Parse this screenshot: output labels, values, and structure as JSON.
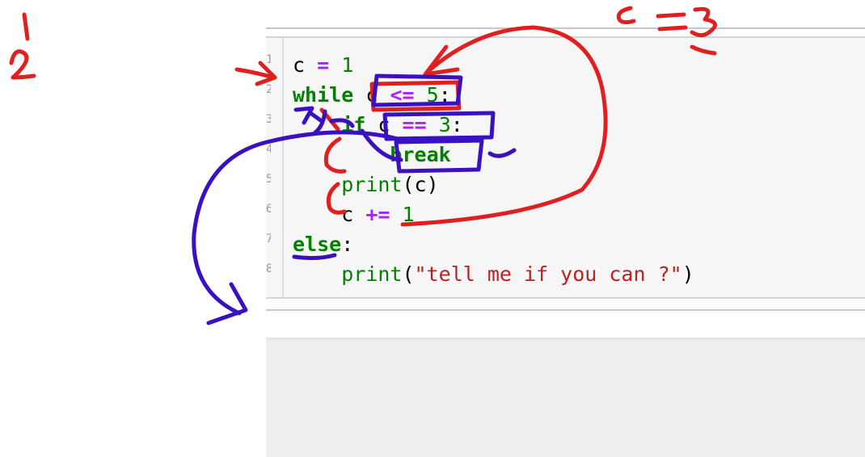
{
  "code": {
    "line1": {
      "var": "c",
      "op": "=",
      "num": "1"
    },
    "line2": {
      "kw": "while",
      "var": "c",
      "op": "<=",
      "num": "5",
      "colon": ":"
    },
    "line3": {
      "kw": "if",
      "var": "c",
      "op": "==",
      "num": "3",
      "colon": ":"
    },
    "line4": {
      "kw": "break"
    },
    "line5": {
      "fn": "print",
      "open": "(",
      "var": "c",
      "close": ")"
    },
    "line6": {
      "var": "c",
      "op": "+=",
      "num": "1"
    },
    "line7": {
      "kw": "else",
      "colon": ":"
    },
    "line8": {
      "fn": "print",
      "open": "(",
      "str": "\"tell me if you can ?\"",
      "close": ")"
    }
  },
  "line_numbers": [
    "1",
    "2",
    "3",
    "4",
    "5",
    "6",
    "7",
    "8"
  ],
  "annotations": {
    "top_left_numerator": "1",
    "top_left_denominator": "2",
    "top_right_note": "c = 3",
    "inline_scribble": "7y"
  },
  "colors": {
    "red_ink": "#e02020",
    "blue_ink": "#3a10c0",
    "keyword": "#008000",
    "operator": "#aa22ff",
    "string": "#ba2121"
  }
}
